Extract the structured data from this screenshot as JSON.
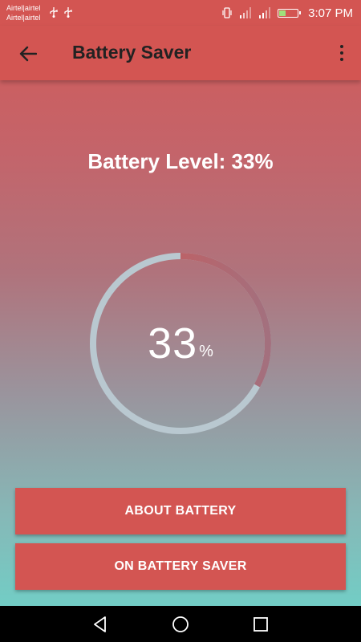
{
  "status_bar": {
    "carrier_line1": "Airtel|airtel",
    "carrier_line2": "Airtel|airtel",
    "time": "3:07 PM",
    "icons": [
      "usb-icon",
      "usb-icon",
      "vibrate-icon",
      "signal-icon",
      "signal-icon",
      "battery-charging-icon"
    ]
  },
  "app_bar": {
    "title": "Battery Saver",
    "back_icon": "arrow-left-icon",
    "menu_icon": "more-vert-icon"
  },
  "battery": {
    "level_text": "Battery Level: 33%",
    "gauge_value": "33",
    "gauge_unit": "%",
    "fraction": 0.33
  },
  "buttons": {
    "about": "ABOUT BATTERY",
    "saver": "ON BATTERY SAVER"
  },
  "nav_bar": {
    "icons": [
      "back-triangle-icon",
      "home-circle-icon",
      "recents-square-icon"
    ]
  },
  "colors": {
    "primary": "#d35552",
    "gauge_track": "#b9c8d0",
    "gauge_progress": "#d35552"
  }
}
